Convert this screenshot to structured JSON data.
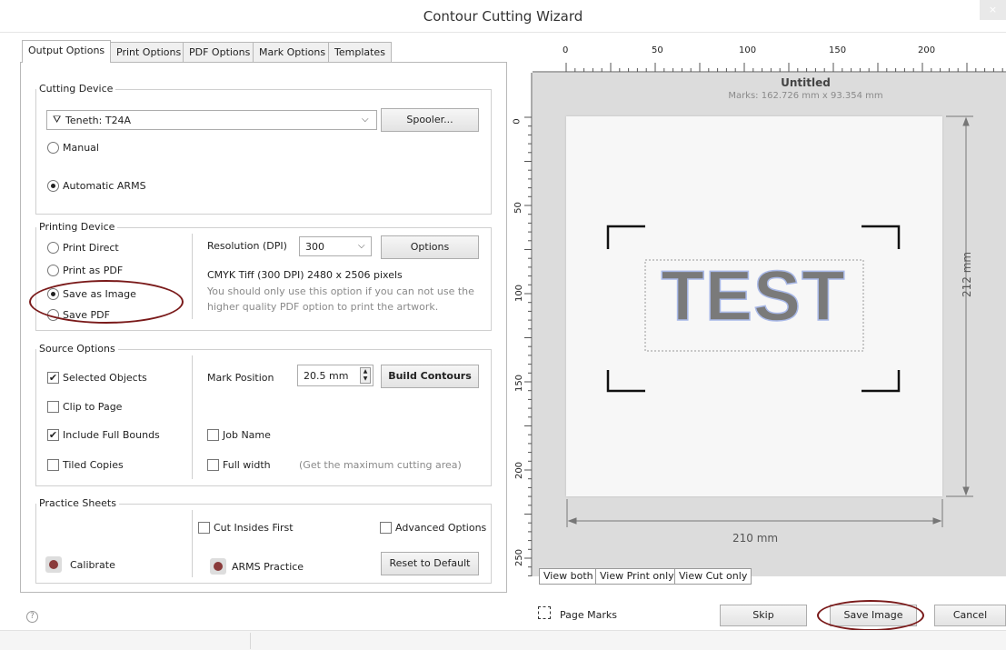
{
  "window": {
    "title": "Contour Cutting Wizard",
    "close_glyph": "×"
  },
  "tabs": [
    {
      "label": "Output Options",
      "active": true
    },
    {
      "label": "Print Options"
    },
    {
      "label": "PDF Options"
    },
    {
      "label": "Mark Options"
    },
    {
      "label": "Templates"
    }
  ],
  "cutting_device": {
    "legend": "Cutting Device",
    "device_value": "Teneth: T24A",
    "spooler_label": "Spooler...",
    "manual_label": "Manual",
    "auto_arms_label": "Automatic ARMS",
    "selected": "Automatic ARMS"
  },
  "printing_device": {
    "legend": "Printing Device",
    "options": [
      "Print Direct",
      "Print as PDF",
      "Save as Image",
      "Save PDF"
    ],
    "selected": "Save as Image",
    "resolution_label": "Resolution (DPI)",
    "resolution_value": "300",
    "options_button": "Options",
    "info_line": "CMYK Tiff  (300 DPI) 2480 x 2506 pixels",
    "note_line1": "You should only use this option if you can not use the",
    "note_line2": "higher quality PDF option to print the artwork."
  },
  "source_options": {
    "legend": "Source Options",
    "selected_objects": "Selected Objects",
    "clip_to_page": "Clip to Page",
    "include_full_bounds": "Include Full Bounds",
    "tiled_copies": "Tiled Copies",
    "mark_position_label": "Mark Position",
    "mark_position_value": "20.5 mm",
    "build_contours": "Build Contours",
    "job_name": "Job Name",
    "full_width": "Full width",
    "full_width_hint": "(Get the maximum cutting area)",
    "checked": [
      "Selected Objects",
      "Include Full Bounds"
    ]
  },
  "practice_sheets": {
    "legend": "Practice Sheets",
    "cut_insides_first": "Cut Insides First",
    "advanced_options": "Advanced Options",
    "calibrate": "Calibrate",
    "arms_practice": "ARMS Practice",
    "reset_to_default": "Reset to Default"
  },
  "help_glyph": "?",
  "preview": {
    "doc_title": "Untitled",
    "marks_info": "Marks: 162.726 mm x 93.354 mm",
    "sample_text": "TEST",
    "width_label": "210 mm",
    "height_label": "212 mm",
    "ruler_top_ticks": [
      "0",
      "50",
      "100",
      "150",
      "200"
    ],
    "ruler_left_ticks": [
      "0",
      "50",
      "100",
      "150",
      "200",
      "250"
    ],
    "view_tabs": [
      "View both",
      "View Print only",
      "View Cut only"
    ]
  },
  "footer": {
    "page_marks": "Page Marks",
    "skip": "Skip",
    "save_image": "Save Image",
    "cancel": "Cancel"
  },
  "colors": {
    "annotation_oval": "#7a1a1a",
    "text_outline": "#a9b9e8",
    "text_fill": "#7a7a7a"
  }
}
